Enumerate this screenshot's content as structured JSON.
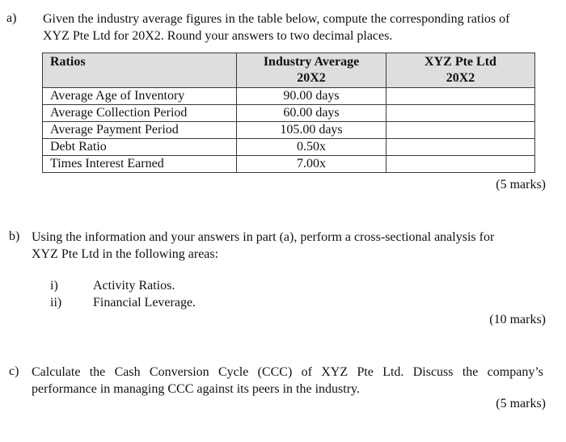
{
  "part_a": {
    "label": "a)",
    "line1": "Given the industry average figures in the table below, compute the corresponding ratios of",
    "line2": "XYZ Pte Ltd for 20X2.  Round your answers to two decimal places.",
    "table": {
      "headers": [
        {
          "line1": "Ratios",
          "line2": ""
        },
        {
          "line1": "Industry Average",
          "line2": "20X2"
        },
        {
          "line1": "XYZ Pte Ltd",
          "line2": "20X2"
        }
      ],
      "rows": [
        {
          "ratio": "Average Age of Inventory",
          "industry": "90.00 days",
          "xyz": ""
        },
        {
          "ratio": "Average Collection Period",
          "industry": "60.00 days",
          "xyz": ""
        },
        {
          "ratio": "Average Payment Period",
          "industry": "105.00 days",
          "xyz": ""
        },
        {
          "ratio": "Debt Ratio",
          "industry": "0.50x",
          "xyz": ""
        },
        {
          "ratio": "Times Interest Earned",
          "industry": "7.00x",
          "xyz": ""
        }
      ]
    },
    "marks": "(5 marks)"
  },
  "part_b": {
    "label": "b)",
    "line1": "Using the information and your answers in part (a), perform a cross-sectional analysis for",
    "line2": "XYZ Pte Ltd in the following areas:",
    "items": [
      {
        "label": "i)",
        "text": "Activity Ratios."
      },
      {
        "label": "ii)",
        "text": "Financial Leverage."
      }
    ],
    "marks": "(10 marks)"
  },
  "part_c": {
    "label": "c)",
    "line1": "Calculate the Cash Conversion Cycle (CCC) of XYZ Pte Ltd. Discuss the company’s",
    "line2": "performance in managing CCC against its peers in the industry.",
    "marks": "(5 marks)"
  }
}
